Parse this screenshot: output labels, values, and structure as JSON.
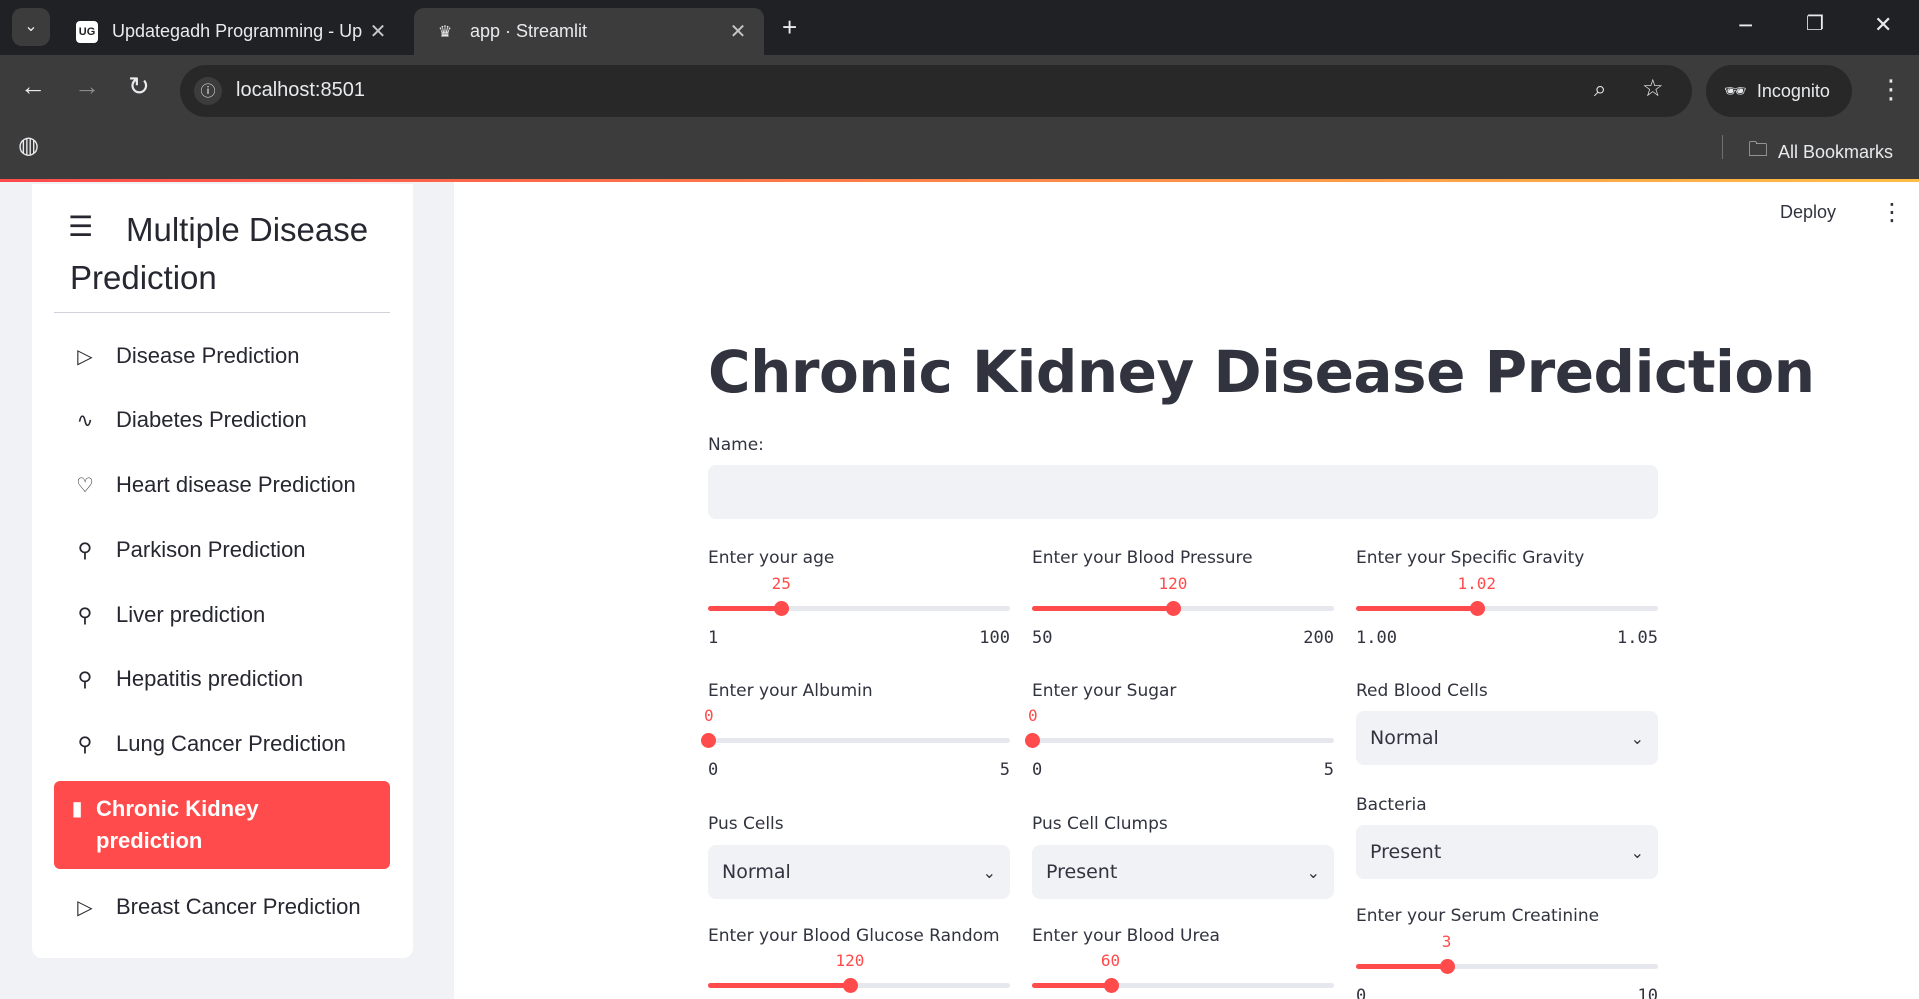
{
  "browser": {
    "tabs": [
      {
        "title": "Updategadh Programming - Up",
        "favicon": "UG"
      },
      {
        "title": "app · Streamlit",
        "favicon": "crown-icon"
      }
    ],
    "url": "localhost:8501",
    "incognito_label": "Incognito",
    "bookmarks_label": "All Bookmarks"
  },
  "sidebar": {
    "title": "Multiple Disease Prediction",
    "items": [
      {
        "label": "Disease Prediction",
        "icon": "play-icon"
      },
      {
        "label": "Diabetes Prediction",
        "icon": "activity-icon"
      },
      {
        "label": "Heart disease Prediction",
        "icon": "heart-icon"
      },
      {
        "label": "Parkison Prediction",
        "icon": "person-icon"
      },
      {
        "label": "Liver prediction",
        "icon": "person-icon"
      },
      {
        "label": "Hepatitis prediction",
        "icon": "person-icon"
      },
      {
        "label": "Lung Cancer Prediction",
        "icon": "person-icon"
      },
      {
        "label": "Chronic Kidney prediction",
        "icon": "bar-chart-icon",
        "active": true
      },
      {
        "label": "Breast Cancer Prediction",
        "icon": "play-icon"
      }
    ]
  },
  "header": {
    "deploy_label": "Deploy"
  },
  "main": {
    "title": "Chronic Kidney Disease Prediction",
    "name_label": "Name:",
    "name_value": "",
    "sliders": {
      "age": {
        "label": "Enter your age",
        "value": "25",
        "min": "1",
        "max": "100",
        "fraction": 0.2424
      },
      "bp": {
        "label": "Enter your Blood Pressure",
        "value": "120",
        "min": "50",
        "max": "200",
        "fraction": 0.4667
      },
      "sg": {
        "label": "Enter your Specific Gravity",
        "value": "1.02",
        "min": "1.00",
        "max": "1.05",
        "fraction": 0.4
      },
      "al": {
        "label": "Enter your Albumin",
        "value": "0",
        "min": "0",
        "max": "5",
        "fraction": 0
      },
      "su": {
        "label": "Enter your Sugar",
        "value": "0",
        "min": "0",
        "max": "5",
        "fraction": 0
      },
      "bgr": {
        "label": "Enter your Blood Glucose Random",
        "value": "120",
        "fraction": 0.47
      },
      "bu": {
        "label": "Enter your Blood Urea",
        "value": "60",
        "fraction": 0.26
      },
      "sc": {
        "label": "Enter your Serum Creatinine",
        "value": "3",
        "min": "0",
        "max": "10",
        "fraction": 0.3
      }
    },
    "selects": {
      "rbc": {
        "label": "Red Blood Cells",
        "value": "Normal"
      },
      "pc": {
        "label": "Pus Cells",
        "value": "Normal"
      },
      "pcc": {
        "label": "Pus Cell Clumps",
        "value": "Present"
      },
      "ba": {
        "label": "Bacteria",
        "value": "Present"
      }
    }
  },
  "colors": {
    "accent": "#ff4b4b",
    "sidebar_bg": "#f0f2f6",
    "text": "#31333f"
  }
}
